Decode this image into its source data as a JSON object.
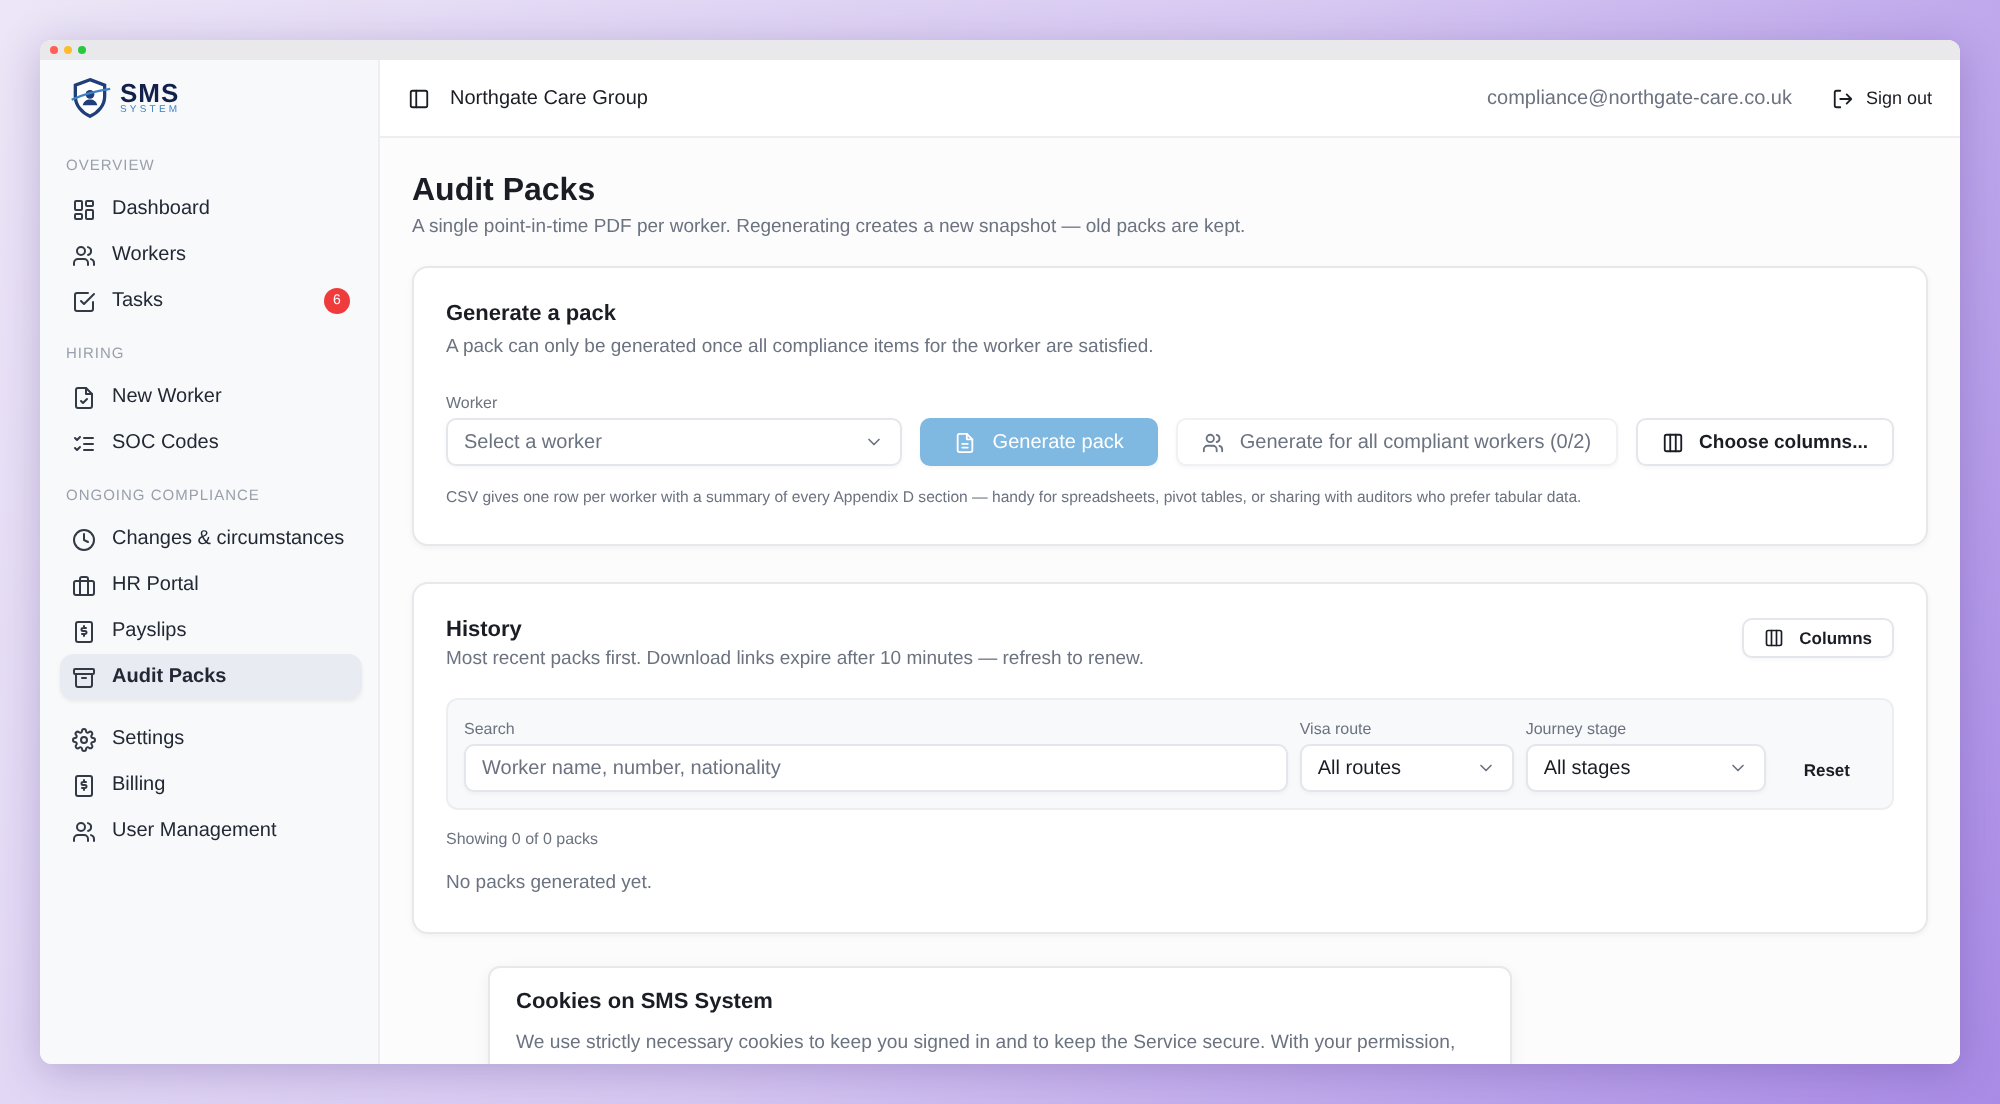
{
  "window": {
    "controls": [
      {
        "color": "#ff5f57"
      },
      {
        "color": "#febc2e"
      },
      {
        "color": "#28c840"
      }
    ]
  },
  "sidebar": {
    "logo": {
      "title": "SMS",
      "subtitle": "SYSTEM"
    },
    "sections": [
      {
        "heading": "OVERVIEW",
        "items": [
          {
            "label": "Dashboard",
            "kind": "grid",
            "selected": false
          },
          {
            "label": "Workers",
            "kind": "users",
            "selected": false
          },
          {
            "label": "Tasks",
            "kind": "checkbox",
            "selected": false,
            "badge": "6"
          }
        ]
      },
      {
        "heading": "HIRING",
        "items": [
          {
            "label": "New Worker",
            "kind": "document",
            "selected": false
          },
          {
            "label": "SOC Codes",
            "kind": "checklist",
            "selected": false
          }
        ]
      },
      {
        "heading": "ONGOING COMPLIANCE",
        "items": [
          {
            "label": "Changes & circumstances",
            "kind": "clock",
            "selected": false
          },
          {
            "label": "HR Portal",
            "kind": "briefcase",
            "selected": false
          },
          {
            "label": "Payslips",
            "kind": "dollar",
            "selected": false
          },
          {
            "label": "Audit Packs",
            "kind": "archive",
            "selected": true
          }
        ]
      },
      {
        "items": [
          {
            "label": "Settings",
            "kind": "gear",
            "selected": false
          },
          {
            "label": "Billing",
            "kind": "dollar",
            "selected": false
          },
          {
            "label": "User Management",
            "kind": "users",
            "selected": false
          }
        ]
      }
    ]
  },
  "header": {
    "organisation": "Northgate Care Group",
    "email": "compliance@northgate-care.co.uk",
    "sign_out": "Sign out"
  },
  "page": {
    "title": "Audit Packs",
    "subtitle": "A single point-in-time PDF per worker. Regenerating creates a new snapshot — old packs are kept."
  },
  "generate": {
    "title": "Generate a pack",
    "description": "A pack can only be generated once all compliance items for the worker are satisfied.",
    "worker": {
      "label": "Worker",
      "placeholder": "Select a worker"
    },
    "buttons": [
      {
        "label": "Generate pack",
        "kind": "primary",
        "disabled": true
      },
      {
        "label": "Generate for all compliant workers (0/2)",
        "kind": "bulk",
        "disabled": true
      },
      {
        "label": "Choose columns...",
        "kind": "columns",
        "disabled": false
      }
    ],
    "note": "CSV gives one row per worker with a summary of every Appendix D section — handy for spreadsheets, pivot tables, or sharing with auditors who prefer tabular data."
  },
  "history": {
    "title": "History",
    "description": "Most recent packs first. Download links expire after 10 minutes — refresh to renew.",
    "columns_button": "Columns",
    "search": {
      "label": "Search",
      "placeholder": "Worker name, number, nationality"
    },
    "filters": [
      {
        "label": "Visa route",
        "value": "All routes"
      },
      {
        "label": "Journey stage",
        "value": "All stages"
      }
    ],
    "reset": "Reset",
    "count": "Showing 0 of 0 packs",
    "empty": "No packs generated yet."
  },
  "cookie_banner": {
    "title": "Cookies on SMS System",
    "text": "We use strictly necessary cookies to keep you signed in and to keep the Service secure. With your permission,"
  }
}
